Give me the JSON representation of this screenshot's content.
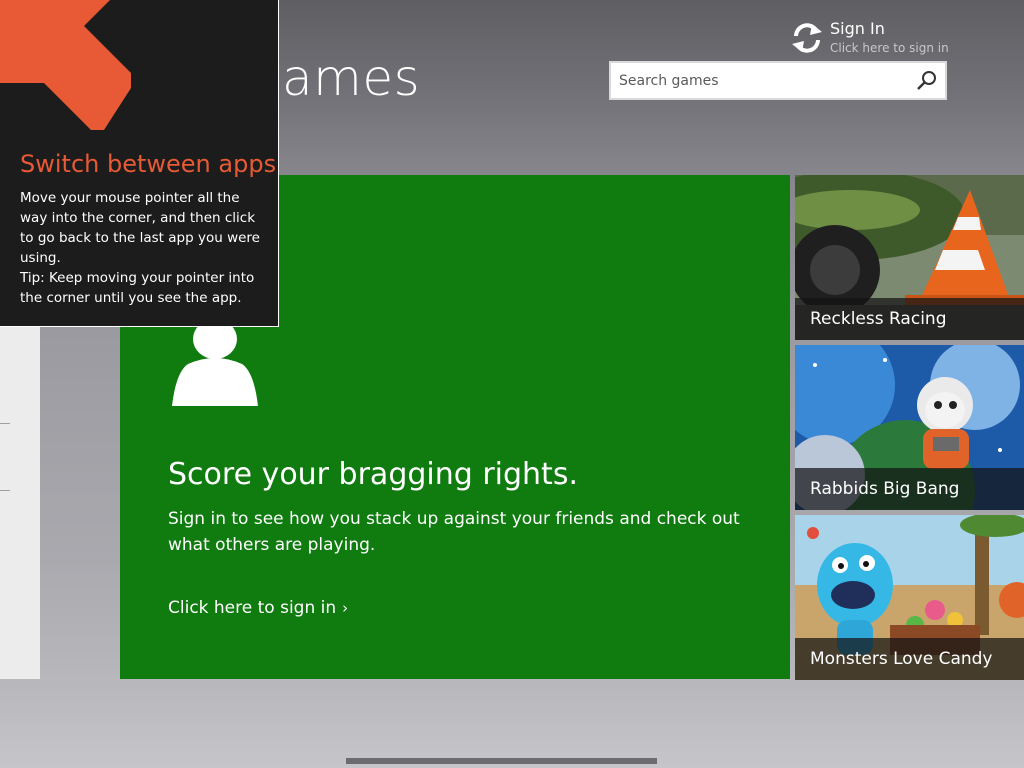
{
  "header": {
    "title": "Games",
    "visible_title_text": "ames",
    "sign_in": {
      "title": "Sign In",
      "subtitle": "Click here to sign in",
      "icon": "sync-icon"
    },
    "search": {
      "placeholder": "Search games",
      "value": "",
      "icon": "search-icon"
    }
  },
  "flyout": {
    "icon": "arrow-up-left-icon",
    "title": "Switch between apps",
    "body_line1": "Move your mouse pointer all the way into the corner, and then click to go back to the last app you were using.",
    "body_line2": "Tip: Keep moving your pointer into the corner until you see the app.",
    "colors": {
      "background": "#1c1c1c",
      "accent": "#e75a35"
    }
  },
  "hero": {
    "icon": "person-icon",
    "title": "Score your bragging rights.",
    "text": "Sign in to see how you stack up against your friends and check out what others are playing.",
    "link": "Click here to sign in",
    "link_chevron": "›",
    "color": "#107c10"
  },
  "tiles": [
    {
      "label": "Reckless Racing"
    },
    {
      "label": "Rabbids Big Bang"
    },
    {
      "label": "Monsters Love Candy"
    }
  ]
}
